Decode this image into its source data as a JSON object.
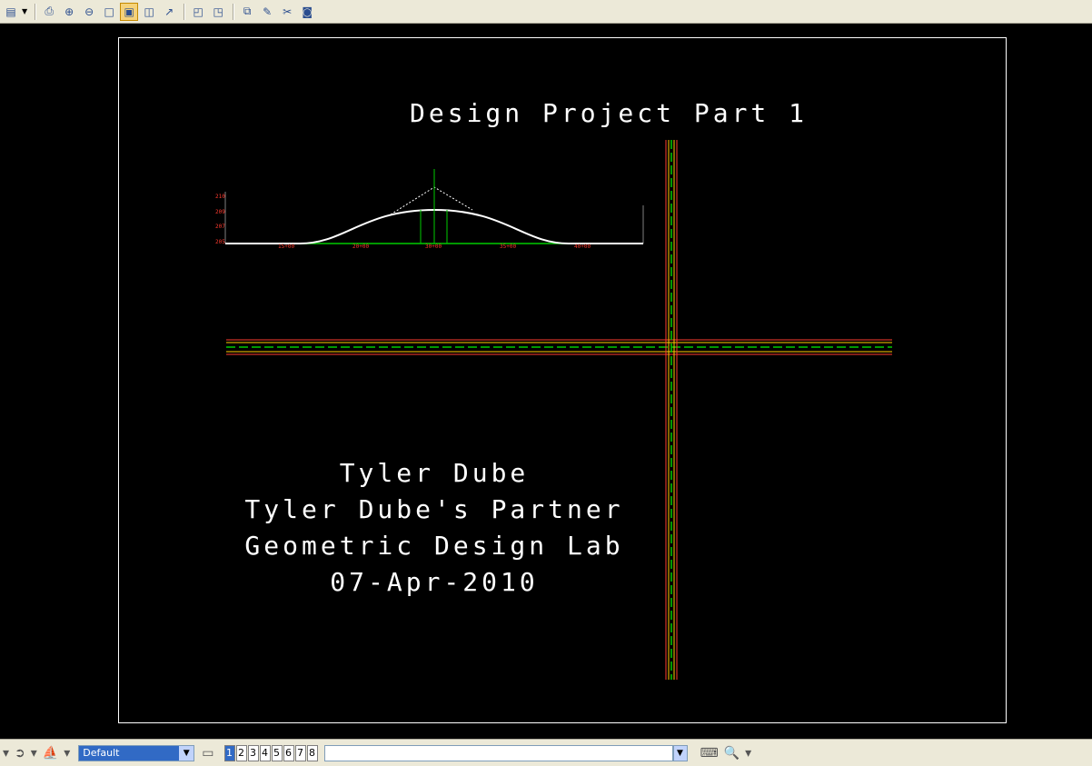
{
  "toolbar": {
    "tools": [
      "views-icon",
      "print-icon",
      "zoom-in-icon",
      "zoom-out-icon",
      "window-area-icon",
      "fit-view-icon",
      "view-icon",
      "rotate-icon",
      "view-previous-icon",
      "view-next-icon",
      "copy-view-icon",
      "display-icon",
      "clip-icon",
      "camera-icon"
    ]
  },
  "drawing": {
    "title": "Design Project Part 1",
    "credits": [
      "Tyler Dube",
      "Tyler Dube's Partner",
      "Geometric Design Lab",
      "07-Apr-2010"
    ],
    "profile_axis_labels": [
      "210",
      "209",
      "207",
      "205"
    ],
    "station_labels": [
      "15+00",
      "20+00",
      "30+00",
      "35+00",
      "40+00"
    ],
    "colors": {
      "background": "#000000",
      "road_edge": "#ff3b2f",
      "centerline": "#00cc00",
      "shoulder": "#ffcc00",
      "text": "#ffffff"
    }
  },
  "statusbar": {
    "view_selector": "Default",
    "view_numbers": [
      "1",
      "2",
      "3",
      "4",
      "5",
      "6",
      "7",
      "8"
    ],
    "active_view": "1",
    "command_input": ""
  }
}
